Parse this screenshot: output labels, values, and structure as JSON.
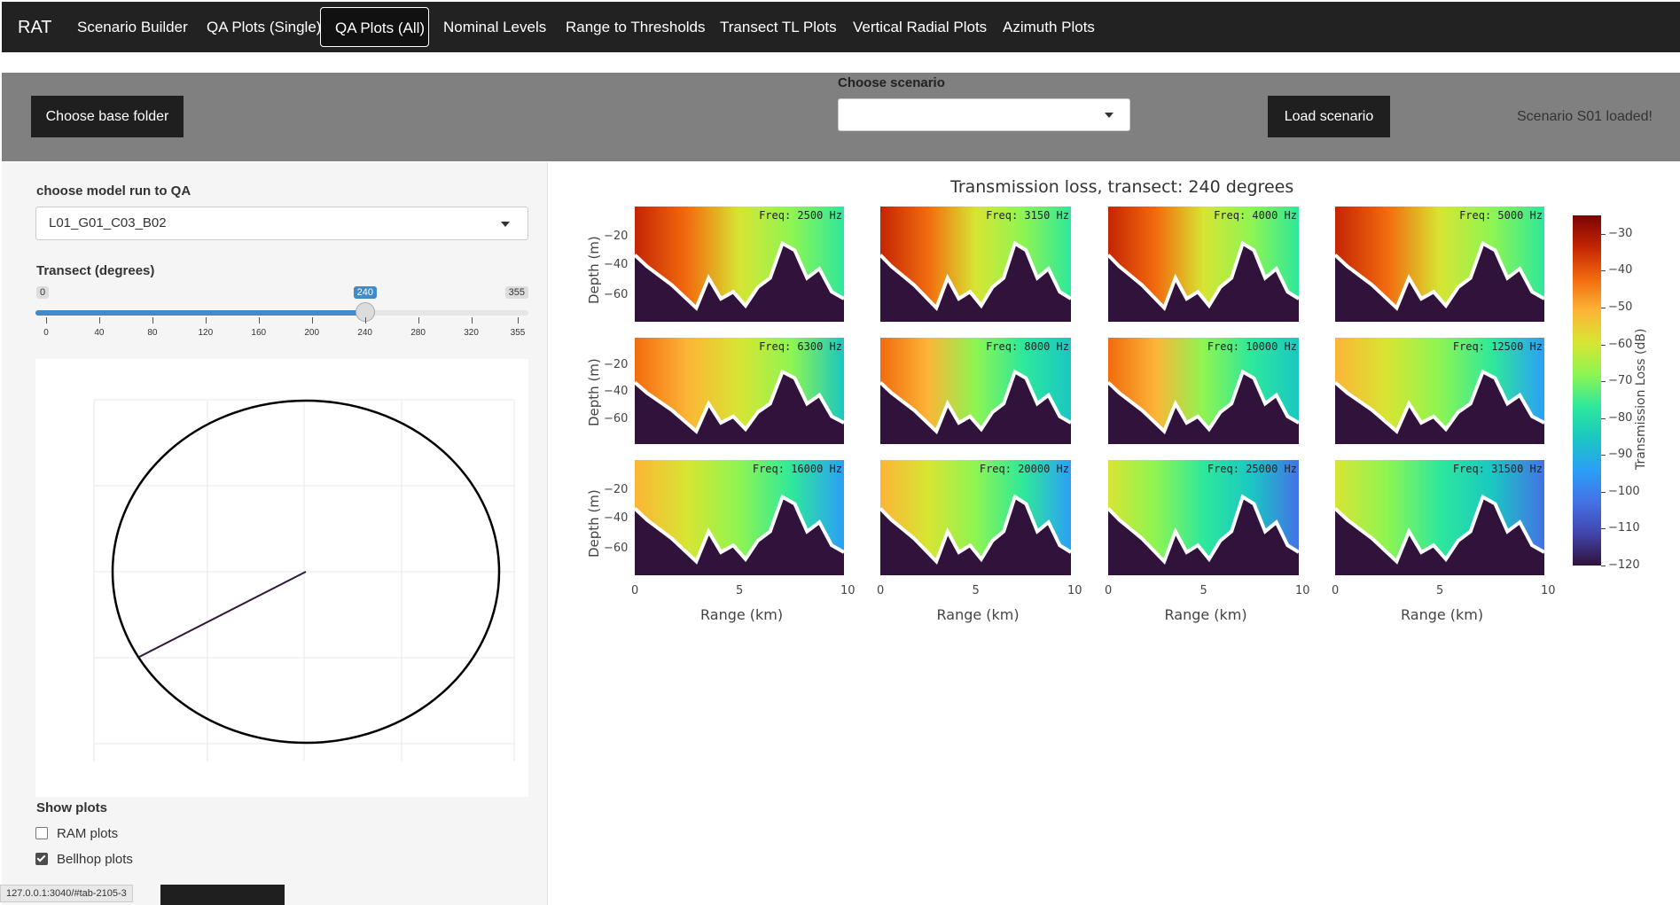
{
  "nav": {
    "brand": "RAT",
    "tabs": [
      {
        "label": "Scenario Builder"
      },
      {
        "label": "QA Plots (Single)"
      },
      {
        "label": "QA Plots (All)"
      },
      {
        "label": "Nominal Levels"
      },
      {
        "label": "Range to Thresholds"
      },
      {
        "label": "Transect TL Plots"
      },
      {
        "label": "Vertical Radial Plots"
      },
      {
        "label": "Azimuth Plots"
      }
    ],
    "active_tab": "QA Plots (All)"
  },
  "topbar": {
    "choose_base_folder": "Choose base folder",
    "choose_scenario_label": "Choose scenario",
    "scenario_value": "",
    "load_scenario": "Load scenario",
    "status": "Scenario S01 loaded!"
  },
  "sidebar": {
    "model_run_label": "choose model run to QA",
    "model_run_value": "L01_G01_C03_B02",
    "transect_label": "Transect (degrees)",
    "slider": {
      "min": 0,
      "max": 355,
      "value": 240,
      "min_label": "0",
      "max_label": "355",
      "value_label": "240",
      "ticks": [
        "0",
        "40",
        "80",
        "120",
        "160",
        "200",
        "240",
        "280",
        "320",
        "355"
      ]
    },
    "compass": {
      "bearing_deg": 240
    },
    "show_plots_label": "Show plots",
    "ram_label": "RAM plots",
    "ram_checked": false,
    "bellhop_label": "Bellhop plots",
    "bellhop_checked": true,
    "url_text": "127.0.0.1:3040/#tab-2105-3"
  },
  "chart_data": {
    "type": "heatmap",
    "title": "Transmission loss, transect: 240 degrees",
    "xlabel": "Range (km)",
    "ylabel": "Depth (m)",
    "xlim": [
      0,
      10
    ],
    "x_ticks": [
      "0",
      "5",
      "10"
    ],
    "y_ticks": [
      "−20",
      "−40",
      "−60"
    ],
    "panels": [
      {
        "freq": "Freq: 2500 Hz"
      },
      {
        "freq": "Freq: 3150 Hz"
      },
      {
        "freq": "Freq: 4000 Hz"
      },
      {
        "freq": "Freq: 5000 Hz"
      },
      {
        "freq": "Freq: 6300 Hz"
      },
      {
        "freq": "Freq: 8000 Hz"
      },
      {
        "freq": "Freq: 10000 Hz"
      },
      {
        "freq": "Freq: 12500 Hz"
      },
      {
        "freq": "Freq: 16000 Hz"
      },
      {
        "freq": "Freq: 20000 Hz"
      },
      {
        "freq": "Freq: 25000 Hz"
      },
      {
        "freq": "Freq: 31500 Hz"
      }
    ],
    "colorbar": {
      "label": "Transmission Loss (dB)",
      "range": [
        -120,
        -25
      ],
      "ticks": [
        "−30",
        "−40",
        "−50",
        "−60",
        "−70",
        "−80",
        "−90",
        "−100",
        "−110",
        "−120"
      ],
      "colors": [
        "#7a0403",
        "#c42503",
        "#f26b0e",
        "#fcb536",
        "#d7e533",
        "#8df552",
        "#2ee89b",
        "#1ac7c2",
        "#2b9ff6",
        "#4472e6",
        "#4145ab",
        "#30123b"
      ]
    },
    "seafloor_color": "#30123b",
    "bathymetry_outline": "#ffffff"
  }
}
